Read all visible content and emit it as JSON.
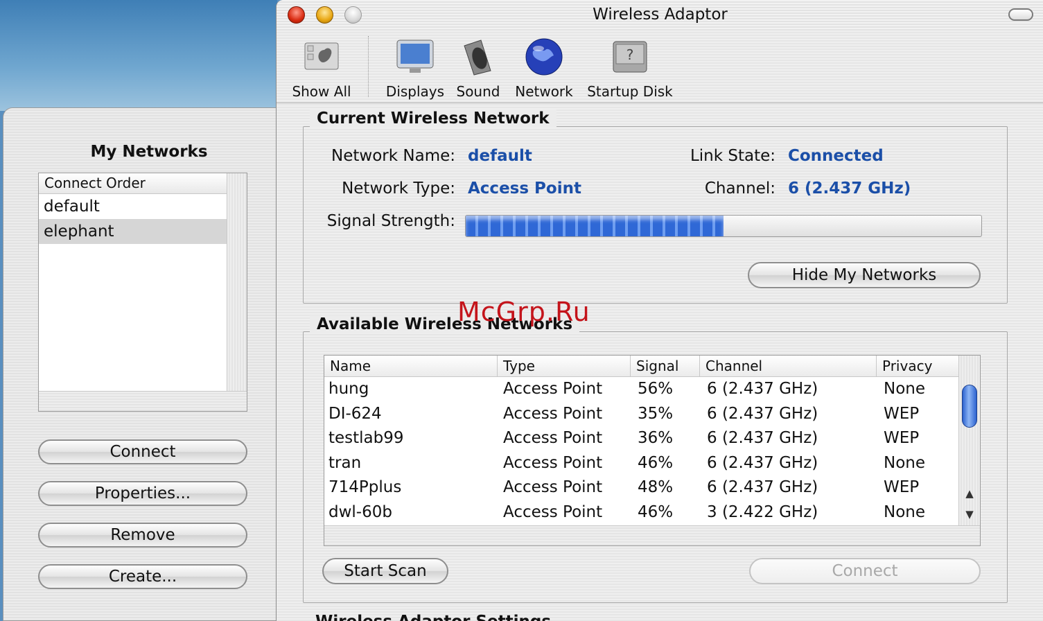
{
  "window": {
    "title": "Wireless Adaptor"
  },
  "toolbar": {
    "items": [
      {
        "label": "Show All",
        "icon": "show-all-icon"
      },
      {
        "label": "Displays",
        "icon": "displays-icon"
      },
      {
        "label": "Sound",
        "icon": "sound-icon"
      },
      {
        "label": "Network",
        "icon": "network-globe-icon"
      },
      {
        "label": "Startup Disk",
        "icon": "startup-disk-icon"
      }
    ]
  },
  "drawer": {
    "title": "My Networks",
    "list_header": "Connect Order",
    "items": [
      "default",
      "elephant"
    ],
    "selected": "elephant",
    "buttons": {
      "connect": "Connect",
      "properties": "Properties...",
      "remove": "Remove",
      "create": "Create..."
    }
  },
  "current": {
    "title": "Current Wireless Network",
    "network_name_label": "Network Name:",
    "network_name": "default",
    "link_state_label": "Link State:",
    "link_state": "Connected",
    "network_type_label": "Network Type:",
    "network_type": "Access Point",
    "channel_label": "Channel:",
    "channel": "6 (2.437 GHz)",
    "signal_label": "Signal Strength:",
    "signal_fraction": 0.5,
    "hide_button": "Hide My Networks"
  },
  "available": {
    "title": "Available Wireless Networks",
    "columns": [
      "Name",
      "Type",
      "Signal",
      "Channel",
      "Privacy"
    ],
    "rows": [
      [
        "hung",
        "Access Point",
        "56%",
        "6 (2.437 GHz)",
        "None"
      ],
      [
        "DI-624",
        "Access Point",
        "35%",
        "6 (2.437 GHz)",
        "WEP"
      ],
      [
        "testlab99",
        "Access Point",
        "36%",
        "6 (2.437 GHz)",
        "WEP"
      ],
      [
        "tran",
        "Access Point",
        "46%",
        "6 (2.437 GHz)",
        "None"
      ],
      [
        "714Pplus",
        "Access Point",
        "48%",
        "6 (2.437 GHz)",
        "WEP"
      ],
      [
        "dwl-60b",
        "Access Point",
        "46%",
        "3 (2.422 GHz)",
        "None"
      ]
    ],
    "start_scan": "Start Scan",
    "connect": "Connect"
  },
  "bottom_section_title": "Wireless Adaptor Settings",
  "watermark": "McGrp.Ru",
  "colors": {
    "value_blue": "#1b4fa8",
    "accent": "#2f68d6",
    "watermark_red": "#c4141b"
  }
}
